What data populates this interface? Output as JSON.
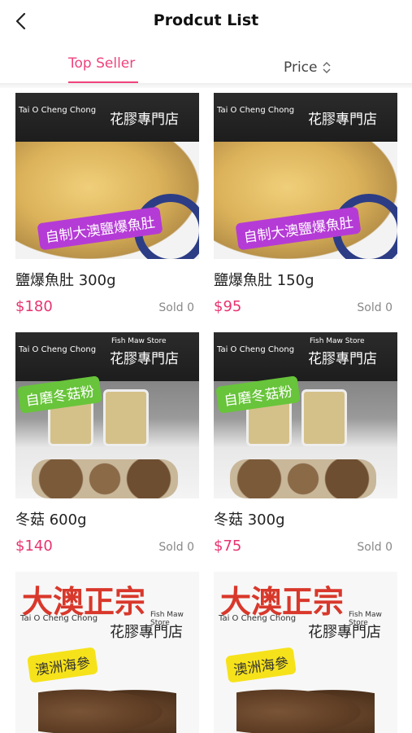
{
  "header": {
    "title": "Prodcut List"
  },
  "tabs": {
    "top_seller": "Top Seller",
    "price": "Price"
  },
  "brand": {
    "cn": "大澳正宗",
    "en_sub": "Tai O Cheng Chong",
    "en_store": "Fish Maw Store",
    "store_cn": "花膠專門店"
  },
  "products": [
    {
      "name": "鹽爆魚肚 300g",
      "price": "$180",
      "sold": "Sold 0",
      "tag": "自制大澳鹽爆魚肚"
    },
    {
      "name": "鹽爆魚肚 150g",
      "price": "$95",
      "sold": "Sold 0",
      "tag": "自制大澳鹽爆魚肚"
    },
    {
      "name": "冬菇 600g",
      "price": "$140",
      "sold": "Sold 0",
      "tag": "自磨冬菇粉"
    },
    {
      "name": "冬菇 300g",
      "price": "$75",
      "sold": "Sold 0",
      "tag": "自磨冬菇粉"
    },
    {
      "tag": "澳洲海參"
    },
    {
      "tag": "澳洲海參"
    }
  ],
  "colors": {
    "accent": "#f0437c",
    "price": "#e8336f"
  }
}
